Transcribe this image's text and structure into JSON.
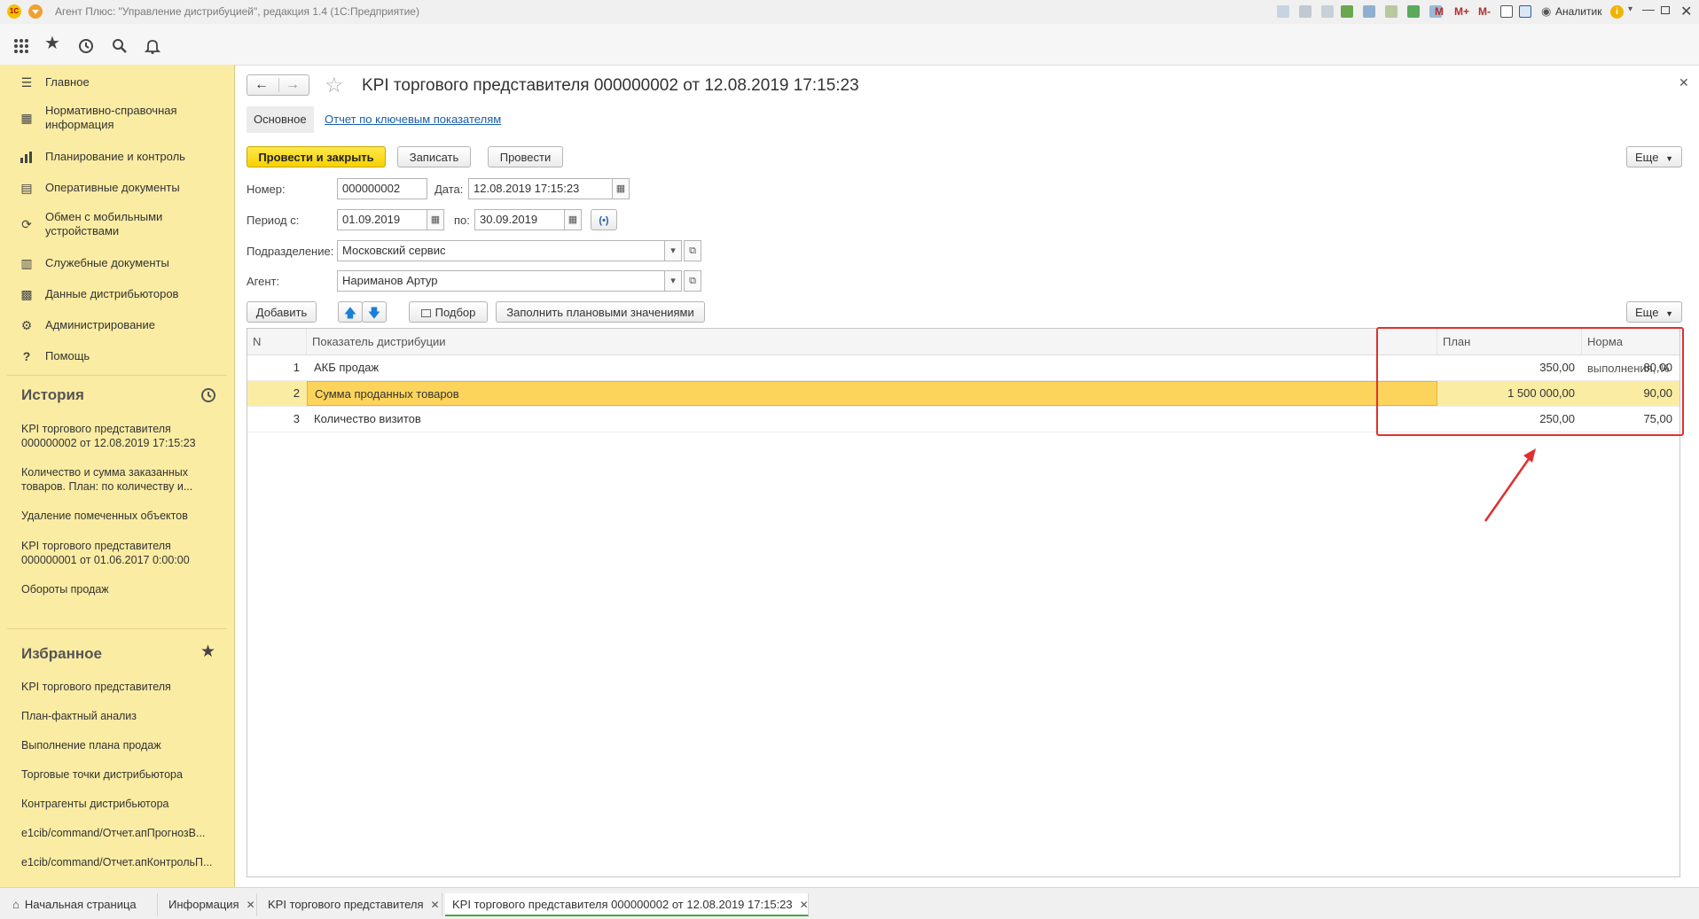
{
  "titlebar": {
    "app_title": "Агент Плюс: \"Управление дистрибуцией\", редакция 1.4  (1С:Предприятие)",
    "user": "Аналитик",
    "m_buttons": [
      "M",
      "M+",
      "M-"
    ]
  },
  "sidebar": {
    "nav": [
      {
        "label": "Главное",
        "icon": "menu-lines-icon"
      },
      {
        "label": "Нормативно-справочная информация",
        "icon": "grid-book-icon"
      },
      {
        "label": "Планирование и контроль",
        "icon": "bar-chart-icon"
      },
      {
        "label": "Оперативные документы",
        "icon": "document-icon"
      },
      {
        "label": "Обмен с мобильными устройствами",
        "icon": "sync-icon"
      },
      {
        "label": "Служебные документы",
        "icon": "document-gear-icon"
      },
      {
        "label": "Данные дистрибьюторов",
        "icon": "distributor-data-icon"
      },
      {
        "label": "Администрирование",
        "icon": "gear-icon"
      },
      {
        "label": "Помощь",
        "icon": "help-icon"
      }
    ],
    "history": {
      "title": "История",
      "items": [
        "KPI торгового представителя 000000002 от 12.08.2019 17:15:23",
        "Количество и сумма заказанных товаров.    План: по количеству и...",
        "Удаление помеченных объектов",
        "KPI торгового представителя 000000001 от 01.06.2017 0:00:00",
        "Обороты продаж"
      ]
    },
    "favorites": {
      "title": "Избранное",
      "items": [
        "KPI торгового представителя",
        "План-фактный анализ",
        "Выполнение плана продаж",
        "Торговые точки дистрибьютора",
        "Контрагенты дистрибьютора",
        "e1cib/command/Отчет.апПрогнозВ...",
        "e1cib/command/Отчет.апКонтрольП..."
      ]
    }
  },
  "document": {
    "title": "KPI торгового представителя 000000002 от 12.08.2019 17:15:23",
    "tabs": [
      "Основное",
      "Отчет по ключевым показателям"
    ],
    "buttons": {
      "post_close": "Провести и закрыть",
      "save": "Записать",
      "post": "Провести",
      "more": "Еще",
      "add": "Добавить",
      "pick": "Подбор",
      "fill_plan": "Заполнить плановыми значениями",
      "more2": "Еще"
    },
    "fields": {
      "number_label": "Номер:",
      "number": "000000002",
      "date_label": "Дата:",
      "date": "12.08.2019 17:15:23",
      "period_from_label": "Период с:",
      "period_from": "01.09.2019",
      "period_to_label": "по:",
      "period_to": "30.09.2019",
      "division_label": "Подразделение:",
      "division": "Московский сервис",
      "agent_label": "Агент:",
      "agent": "Нариманов Артур"
    }
  },
  "table": {
    "columns": [
      "N",
      "Показатель дистрибуции",
      "План",
      "Норма выполнения, %"
    ],
    "rows": [
      {
        "n": "1",
        "name": "АКБ продаж",
        "plan": "350,00",
        "norm": "80,00"
      },
      {
        "n": "2",
        "name": "Сумма проданных товаров",
        "plan": "1 500 000,00",
        "norm": "90,00"
      },
      {
        "n": "3",
        "name": "Количество визитов",
        "plan": "250,00",
        "norm": "75,00"
      }
    ],
    "selected_row": 2
  },
  "bottom_tabs": [
    {
      "label": "Начальная страница"
    },
    {
      "label": "Информация"
    },
    {
      "label": "KPI торгового представителя"
    },
    {
      "label": "KPI торгового представителя 000000002 от 12.08.2019 17:15:23"
    }
  ],
  "colors": {
    "sidebar_bg": "#fbeca3",
    "primary_button": "#f5d200",
    "highlight_box": "#e03030",
    "link": "#1a5fa8"
  }
}
